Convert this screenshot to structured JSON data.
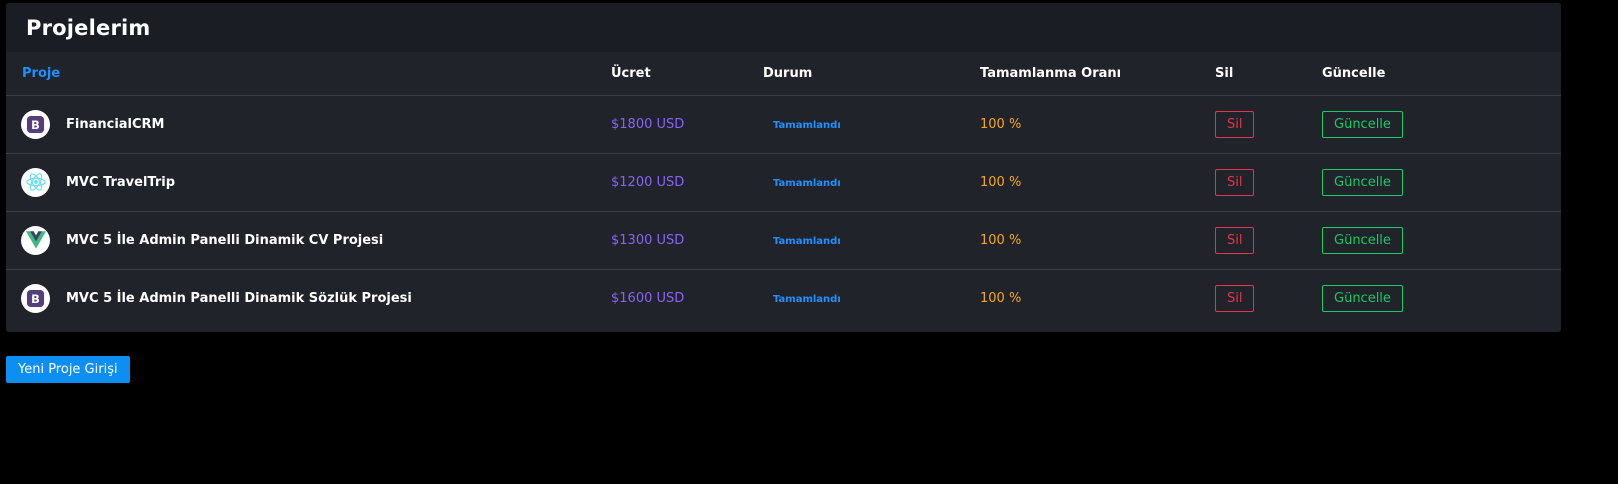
{
  "card": {
    "title": "Projelerim"
  },
  "table": {
    "headers": {
      "proje": "Proje",
      "ucret": "Ücret",
      "durum": "Durum",
      "oran": "Tamamlanma Oranı",
      "sil": "Sil",
      "guncelle": "Güncelle"
    },
    "rows": [
      {
        "icon": "bootstrap-icon",
        "name": "FinancialCRM",
        "price": "$1800 USD",
        "status": "Tamamlandı",
        "progress": "100 %",
        "delete_label": "Sil",
        "update_label": "Güncelle"
      },
      {
        "icon": "react-icon",
        "name": "MVC TravelTrip",
        "price": "$1200 USD",
        "status": "Tamamlandı",
        "progress": "100 %",
        "delete_label": "Sil",
        "update_label": "Güncelle"
      },
      {
        "icon": "vue-icon",
        "name": "MVC 5 İle Admin Panelli Dinamik CV Projesi",
        "price": "$1300 USD",
        "status": "Tamamlandı",
        "progress": "100 %",
        "delete_label": "Sil",
        "update_label": "Güncelle"
      },
      {
        "icon": "bootstrap-icon",
        "name": "MVC 5 İle Admin Panelli Dinamik Sözlük Projesi",
        "price": "$1600 USD",
        "status": "Tamamlandı",
        "progress": "100 %",
        "delete_label": "Sil",
        "update_label": "Güncelle"
      }
    ]
  },
  "actions": {
    "new_project_label": "Yeni Proje Girişi"
  },
  "colors": {
    "accent_blue": "#1e90ff",
    "price_purple": "#8a63f5",
    "progress_orange": "#f5a623",
    "danger_red": "#e0374a",
    "success_green": "#18c964"
  }
}
